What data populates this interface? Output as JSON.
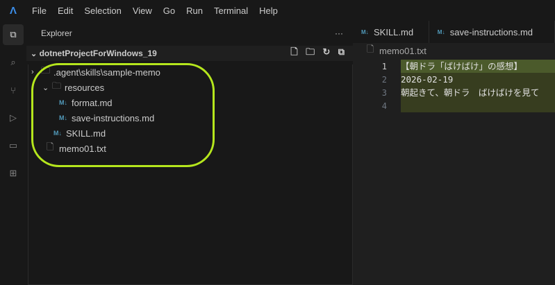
{
  "menu": [
    "File",
    "Edit",
    "Selection",
    "View",
    "Go",
    "Run",
    "Terminal",
    "Help"
  ],
  "activity": [
    "explorer-icon",
    "search-icon",
    "source-control-icon",
    "run-debug-icon",
    "remote-explorer-icon",
    "extensions-icon"
  ],
  "sidebar": {
    "title": "Explorer",
    "more": "···",
    "root": "dotnetProjectForWindows_19",
    "tree": [
      {
        "label": ".agent\\skills\\sample-memo",
        "type": "folder",
        "depth": 0,
        "chevron": "›"
      },
      {
        "label": "resources",
        "type": "folder",
        "depth": 1,
        "chevron": "⌄"
      },
      {
        "label": "format.md",
        "type": "md",
        "depth": 2
      },
      {
        "label": "save-instructions.md",
        "type": "md",
        "depth": 2
      },
      {
        "label": "SKILL.md",
        "type": "md",
        "depth": 1
      },
      {
        "label": "memo01.txt",
        "type": "txt",
        "depth": 0
      }
    ]
  },
  "editor": {
    "tabs": [
      {
        "label": "SKILL.md"
      },
      {
        "label": "save-instructions.md"
      }
    ],
    "breadcrumb": "memo01.txt",
    "lines": [
      {
        "n": "1",
        "text": "【朝ドラ「ばけばけ」の感想】"
      },
      {
        "n": "2",
        "text": "2026-02-19"
      },
      {
        "n": "3",
        "text": "朝起きて、朝ドラ　ばけばけを見て"
      },
      {
        "n": "4",
        "text": ""
      }
    ]
  },
  "colors": {
    "annotation": "#b5e61d",
    "line_highlight": "#4b5a2b",
    "added_lines": "#373d1f"
  }
}
